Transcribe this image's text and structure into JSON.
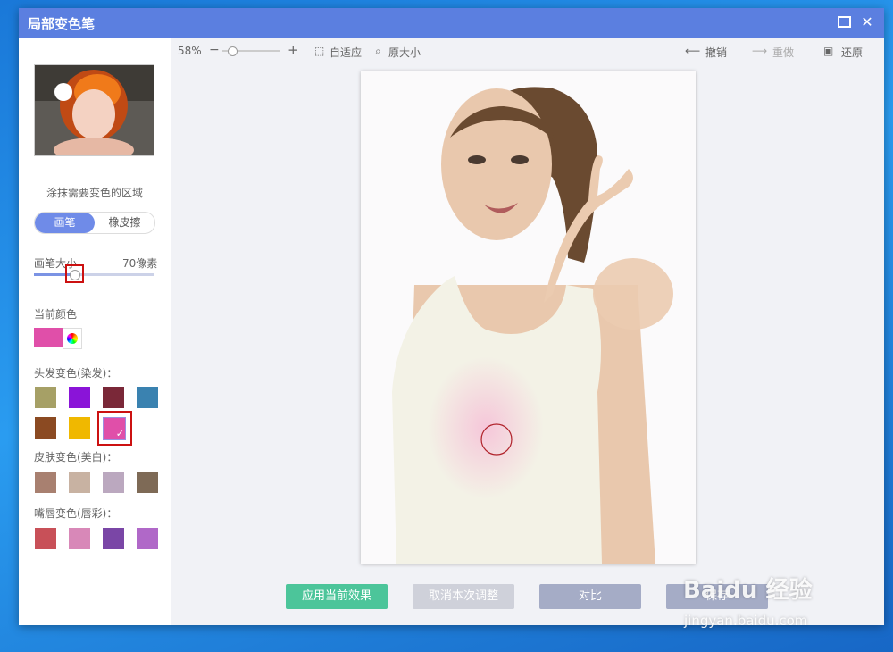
{
  "window": {
    "title": "局部变色笔",
    "maximize": "□",
    "close": "✕"
  },
  "sidebar": {
    "hint": "涂抹需要变色的区域",
    "tabs": {
      "brush": "画笔",
      "eraser": "橡皮擦"
    },
    "brush_size": {
      "label": "画笔大小",
      "value": "70像素",
      "level_fraction": 0.32
    },
    "current_color_label": "当前颜色",
    "current_color": "#e04fa9",
    "hair_label": "头发变色(染发)：",
    "hair_colors": [
      "#a6a066",
      "#8a14d8",
      "#7a2838",
      "#3a82b0",
      "#8b4a22",
      "#f0b800",
      "#e04fa9"
    ],
    "skin_label": "皮肤变色(美白)：",
    "skin_colors": [
      "#a88070",
      "#c8b2a2",
      "#bba8bf",
      "#7e6a56"
    ],
    "lip_label": "嘴唇变色(唇彩)：",
    "lip_colors": [
      "#c85058",
      "#d888b8",
      "#7a46a6",
      "#b068c8"
    ]
  },
  "toolbar": {
    "zoom": "58%",
    "minus": "−",
    "plus": "+",
    "fit": "自适应",
    "original_size": "原大小",
    "undo": "撤销",
    "redo": "重做",
    "restore": "还原"
  },
  "actions": {
    "apply": "应用当前效果",
    "cancel": "取消本次调整",
    "compare": "对比",
    "save": "保存"
  },
  "watermark": {
    "brand": "Baidu 经验",
    "url": "jingyan.baidu.com"
  }
}
